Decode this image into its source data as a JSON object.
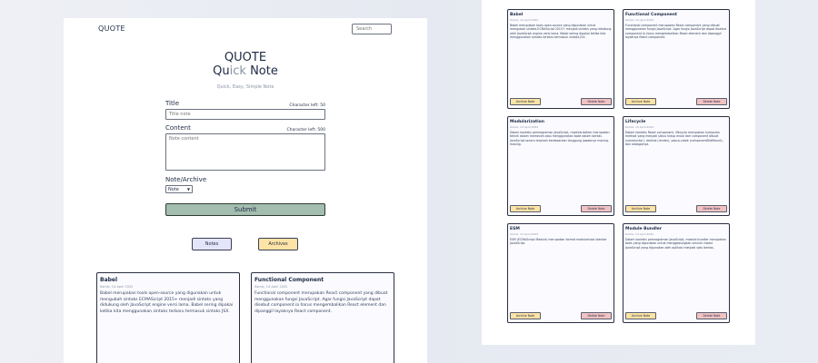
{
  "left": {
    "brand": "QUOTE",
    "search_placeholder": "Search",
    "hero": {
      "line1": "QUOTE",
      "line2_a": "Qu",
      "line2_b": "ick",
      "line2_c": " Note",
      "tagline": "Quick, Easy, Simple Note"
    },
    "form": {
      "title_label": "Title",
      "title_char_left": "Character left: 50",
      "title_placeholder": "Title note",
      "content_label": "Content",
      "content_char_left": "Character left: 500",
      "content_placeholder": "Note content",
      "type_label": "Note/Archive",
      "type_selected": "Note",
      "submit_label": "Submit"
    },
    "tabs": {
      "notes": "Notes",
      "archives": "Archives"
    },
    "cards": [
      {
        "title": "Babel",
        "date": "Kamis, 14 April 2022",
        "body": "Babel merupakan tools open-source yang digunakan untuk mengubah sintaks ECMAScript 2015+ menjadi sintaks yang didukung oleh JavaScript engine versi lama. Babel sering dipakai ketika kita menggunakan sintaks terbaru termasuk sintaks JSX."
      },
      {
        "title": "Functional Component",
        "date": "Kamis, 14 April 2022",
        "body": "Functional component merupakan React component yang dibuat menggunakan fungsi JavaScript. Agar fungsi JavaScript dapat disebut component ia harus mengembalikan React element dan dipanggil layaknya React component."
      }
    ]
  },
  "right": {
    "archive_label": "Archive Note",
    "delete_label": "Delete Note",
    "cards": [
      {
        "title": "Babel",
        "date": "Kamis, 14 April 2022",
        "body": "Babel merupakan tools open-source yang digunakan untuk mengubah sintaks ECMAScript 2015+ menjadi sintaks yang didukung oleh JavaScript engine versi lama. Babel sering dipakai ketika kita menggunakan sintaks terbaru termasuk sintaks JSX."
      },
      {
        "title": "Functional Component",
        "date": "Kamis, 14 April 2022",
        "body": "Functional component merupakan React component yang dibuat menggunakan fungsi JavaScript. Agar fungsi JavaScript dapat disebut component ia harus mengembalikan React element dan dipanggil layaknya React component."
      },
      {
        "title": "Modularization",
        "date": "Kamis, 14 April 2022",
        "body": "Dalam konteks pemrograman JavaScript, modularization merupakan teknik dalam memecah atau menggunakan kode dalam berkas JavaScript secara terpisah berdasarkan tanggung jawabnya masing-masing."
      },
      {
        "title": "Lifecycle",
        "date": "Kamis, 14 April 2022",
        "body": "Dalam konteks React component, lifecycle merupakan kumpulan method yang menjadi siklus hidup mulai dari component dibuat (constructor), dicetak (render), pasca-cetak (componentDidMount), dan sebagainya."
      },
      {
        "title": "ESM",
        "date": "Kamis, 14 April 2022",
        "body": "ESM (ECMAScript Module) merupakan format modularisasi standar JavaScript."
      },
      {
        "title": "Module Bundler",
        "date": "Kamis, 14 April 2022",
        "body": "Dalam konteks pemrograman JavaScript, module bundler merupakan tools yang digunakan untuk menggabungkan seluruh modul JavaScript yang digunakan oleh aplikasi menjadi satu berkas."
      }
    ]
  },
  "colors": {
    "submit": "#a3bdaf",
    "notes_tab": "#e4e4fb",
    "archives_tab": "#fde3a5",
    "delete": "#f2c2c2"
  }
}
